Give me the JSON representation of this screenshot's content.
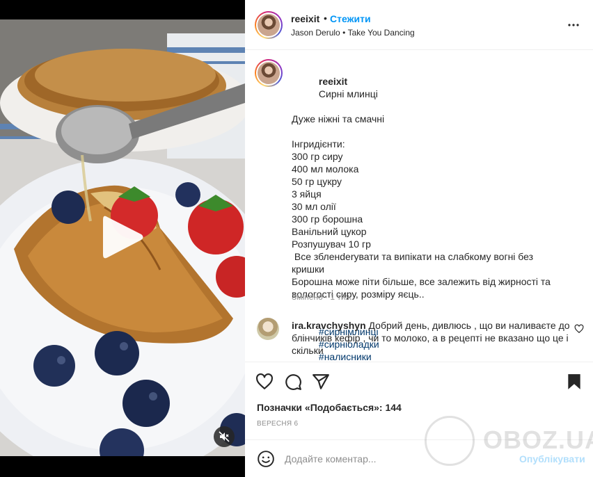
{
  "post": {
    "username": "reeixit",
    "separator": "•",
    "follow_label": "Стежити",
    "music": {
      "artist": "Jason Derulo",
      "dot": "•",
      "track": "Take You Dancing"
    }
  },
  "caption": {
    "username": "reeixit",
    "title": "Сирні млинці",
    "lines": [
      "Дуже ніжні та смачні",
      "",
      "Інгридієнти:",
      "300 гр сиру",
      "400 мл молока",
      "50 гр цукру",
      "3 яйця",
      "30 мл олії",
      "300 гр борошна",
      "Ванільний цукор",
      "Розпушувач 10 гр",
      " Все збленderувати та випікати на слабкому вогні без",
      "кришки",
      "Борошна може піти більше, все залежить від жирності та",
      "вологості сиру, розміру яєць.."
    ],
    "hashtags": [
      "#сирнімлинці",
      "#сирніоладки",
      "#налисники"
    ],
    "edited": "Змінено · 1 тиж."
  },
  "comment": {
    "username": "ira.kravchyshyn",
    "text": "Добрий день, дивлюсь , що ви наливаєте до блінчиків кефір , чи то молоко, а в рецепті не вказано що це і скільки"
  },
  "likes_text": "Позначки «Подобається»: 144",
  "date_text": "вересня 6",
  "composer": {
    "placeholder": "Додайте коментар...",
    "post_label": "Опублікувати"
  },
  "watermark": {
    "text": "OBOZ.UA"
  },
  "colors": {
    "link_blue": "#0095f6",
    "hashtag_blue": "#00376b",
    "post_disabled": "#b2dffc",
    "muted_text": "#8e8e8e"
  },
  "icons": {
    "like": "heart-icon",
    "comment": "speech-bubble-icon",
    "share": "paper-plane-icon",
    "save": "bookmark-icon",
    "more": "ellipsis-icon",
    "play": "play-icon",
    "mute": "speaker-muted-icon",
    "emoji": "smiley-icon"
  }
}
